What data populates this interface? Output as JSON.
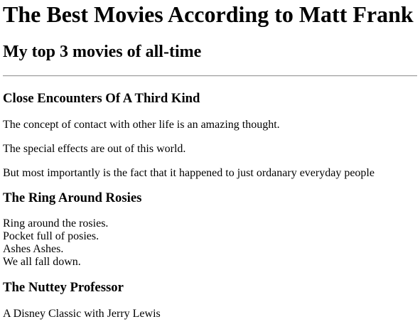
{
  "page": {
    "title": "The Best Movies According to Matt Frank",
    "subtitle": "My top 3 movies of all-time"
  },
  "movies": [
    {
      "title": "Close Encounters Of A Third Kind",
      "paragraphs": [
        "The concept of contact with other life is an amazing thought.",
        "The special effects are out of this world.",
        "But most importantly is the fact that it happened to just ordanary everyday people"
      ]
    },
    {
      "title": "The Ring Around Rosies",
      "lines": [
        "Ring around the rosies.",
        "Pocket full of posies.",
        "Ashes Ashes.",
        "We all fall down."
      ]
    },
    {
      "title": "The Nuttey Professor",
      "paragraphs": [
        "A Disney Classic with Jerry Lewis"
      ]
    }
  ]
}
